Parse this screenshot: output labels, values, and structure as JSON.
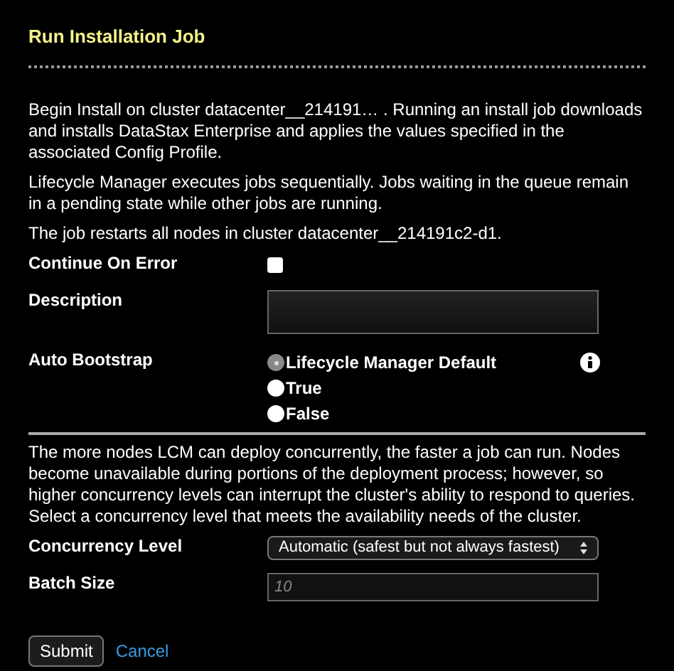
{
  "title": "Run Installation Job",
  "paragraphs": [
    "Begin Install on cluster datacenter__214191… . Running an install job downloads and installs DataStax Enterprise and applies the values specified in the associated Config Profile.",
    "Lifecycle Manager executes jobs sequentially. Jobs waiting in the queue remain in a pending state while other jobs are running.",
    "The job restarts all nodes in cluster datacenter__214191c2-d1."
  ],
  "continue_on_error": {
    "label": "Continue On Error",
    "checked": false
  },
  "description": {
    "label": "Description"
  },
  "auto_bootstrap": {
    "label": "Auto Bootstrap",
    "options": [
      {
        "label": "Lifecycle Manager Default",
        "selected": true
      },
      {
        "label": "True",
        "selected": false
      },
      {
        "label": "False",
        "selected": false
      }
    ]
  },
  "concurrency_note": "The more nodes LCM can deploy concurrently, the faster a job can run. Nodes become unavailable during portions of the deployment process; however, so higher concurrency levels can interrupt the cluster's ability to respond to queries. Select a concurrency level that meets the availability needs of the cluster.",
  "concurrency_level": {
    "label": "Concurrency Level",
    "value": "Automatic (safest but not always fastest)"
  },
  "batch_size": {
    "label": "Batch Size",
    "placeholder": "10"
  },
  "buttons": {
    "submit": "Submit",
    "cancel": "Cancel"
  }
}
